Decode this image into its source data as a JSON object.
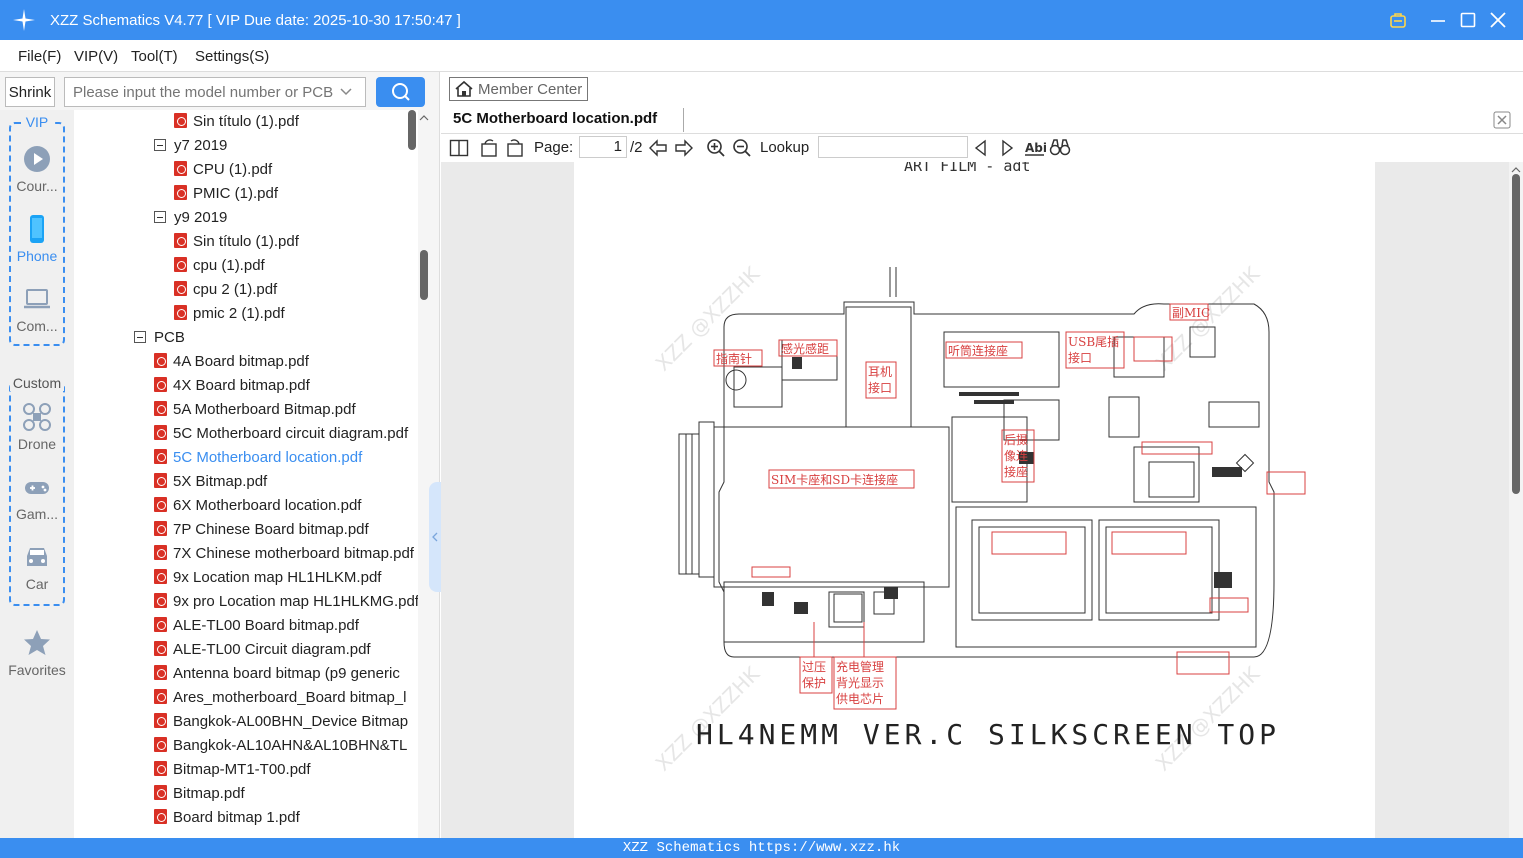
{
  "window": {
    "title": "XZZ Schematics V4.77 [ VIP Due date: 2025-10-30 17:50:47 ]"
  },
  "menu": [
    "File(F)",
    "VIP(V)",
    "Tool(T)",
    "Settings(S)"
  ],
  "sidebar": {
    "shrink_label": "Shrink",
    "search_placeholder": "Please input the model number or PCB",
    "vip_label": "VIP",
    "custom_label": "Custom",
    "categories": [
      "Cour...",
      "Phone",
      "Com...",
      "Drone",
      "Gam...",
      "Car",
      "Favorites"
    ],
    "active_category": "Phone",
    "tree": [
      {
        "type": "file",
        "label": "Sin título (1).pdf",
        "level": 2
      },
      {
        "type": "folder",
        "label": "y7 2019",
        "level": 1
      },
      {
        "type": "file",
        "label": "CPU (1).pdf",
        "level": 2
      },
      {
        "type": "file",
        "label": "PMIC (1).pdf",
        "level": 2
      },
      {
        "type": "folder",
        "label": "y9 2019",
        "level": 1
      },
      {
        "type": "file",
        "label": "Sin título (1).pdf",
        "level": 2
      },
      {
        "type": "file",
        "label": "cpu (1).pdf",
        "level": 2
      },
      {
        "type": "file",
        "label": "cpu 2 (1).pdf",
        "level": 2
      },
      {
        "type": "file",
        "label": "pmic 2 (1).pdf",
        "level": 2
      },
      {
        "type": "folder",
        "label": "PCB",
        "level": 0
      },
      {
        "type": "file",
        "label": "4A Board bitmap.pdf",
        "level": 1
      },
      {
        "type": "file",
        "label": "4X Board bitmap.pdf",
        "level": 1
      },
      {
        "type": "file",
        "label": "5A Motherboard Bitmap.pdf",
        "level": 1
      },
      {
        "type": "file",
        "label": "5C Motherboard circuit diagram.pdf",
        "level": 1
      },
      {
        "type": "file",
        "label": "5C Motherboard location.pdf",
        "level": 1,
        "selected": true
      },
      {
        "type": "file",
        "label": "5X Bitmap.pdf",
        "level": 1
      },
      {
        "type": "file",
        "label": "6X Motherboard location.pdf",
        "level": 1
      },
      {
        "type": "file",
        "label": "7P Chinese Board bitmap.pdf",
        "level": 1
      },
      {
        "type": "file",
        "label": "7X Chinese motherboard bitmap.pdf",
        "level": 1
      },
      {
        "type": "file",
        "label": "9x Location map HL1HLKM.pdf",
        "level": 1
      },
      {
        "type": "file",
        "label": "9x pro Location map HL1HLKMG.pdf",
        "level": 1
      },
      {
        "type": "file",
        "label": "ALE-TL00 Board bitmap.pdf",
        "level": 1
      },
      {
        "type": "file",
        "label": "ALE-TL00 Circuit diagram.pdf",
        "level": 1
      },
      {
        "type": "file",
        "label": "Antenna board bitmap (p9 generic",
        "level": 1
      },
      {
        "type": "file",
        "label": "Ares_motherboard_Board bitmap_l",
        "level": 1
      },
      {
        "type": "file",
        "label": "Bangkok-AL00BHN_Device Bitmap",
        "level": 1
      },
      {
        "type": "file",
        "label": "Bangkok-AL10AHN&AL10BHN&TL",
        "level": 1
      },
      {
        "type": "file",
        "label": "Bitmap-MT1-T00.pdf",
        "level": 1
      },
      {
        "type": "file",
        "label": "Bitmap.pdf",
        "level": 1
      },
      {
        "type": "file",
        "label": "Board bitmap 1.pdf",
        "level": 1
      }
    ]
  },
  "viewer": {
    "member_center": "Member Center",
    "tab_title": "5C Motherboard location.pdf",
    "page_label": "Page:",
    "page_current": "1",
    "page_total": "/2",
    "lookup_label": "Lookup",
    "doc": {
      "header": "ART FILM - adt",
      "silkscreen": "HL4NEMM VER.C SILKSCREEN TOP",
      "watermark": "XZZ @XZZHK",
      "labels": [
        "指南针",
        "感光感距",
        "耳机",
        "接口",
        "听筒连接座",
        "USB尾插",
        "接口",
        "副MIC",
        "后摄",
        "像连",
        "接座",
        "SIM卡座和SD卡连接座",
        "过压",
        "保护",
        "充电管理",
        "背光显示",
        "供电芯片"
      ]
    }
  },
  "footer": "XZZ Schematics https://www.xzz.hk",
  "colors": {
    "accent": "#3a8ef0",
    "pdf_icon": "#d93025",
    "annotation": "#d84040"
  }
}
